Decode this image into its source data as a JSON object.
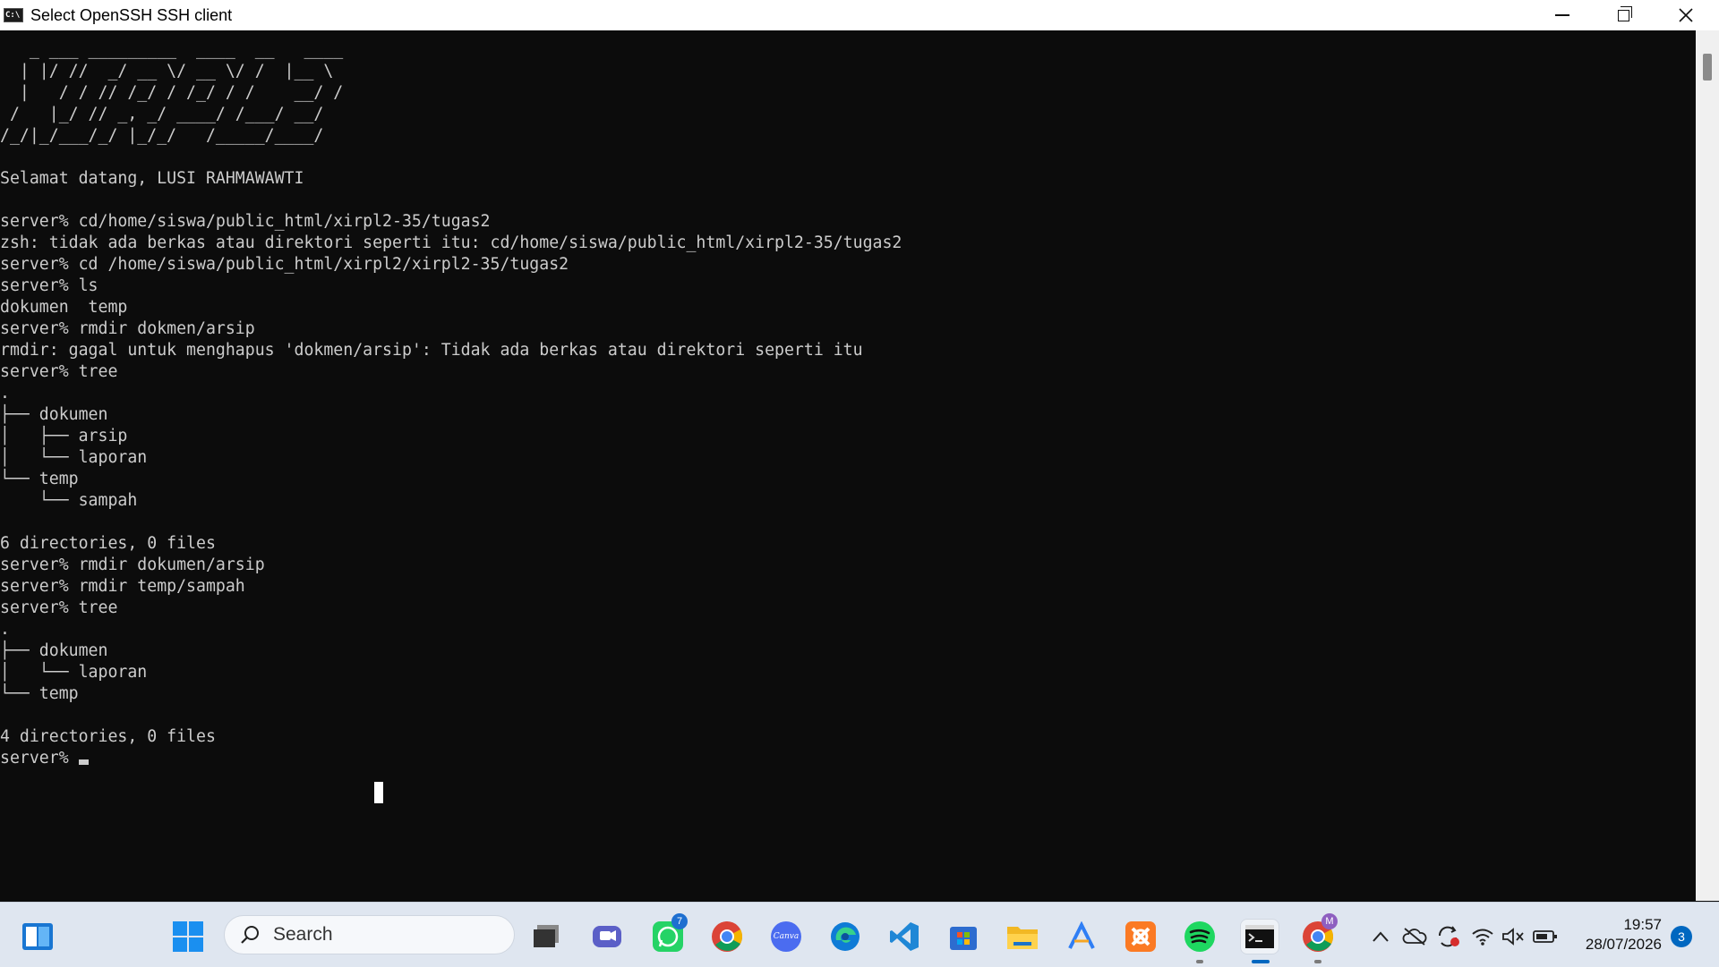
{
  "window": {
    "title": "Select OpenSSH SSH client"
  },
  "console": {
    "lines": [
      "   _ ___ _________  ____  __   ____",
      "  | |/ //  _/ __ \\/ __ \\/ /  |__ \\",
      "  |   / / // /_/ / /_/ / /    __/ /",
      " /   |_/ // _, _/ ____/ /___/ __/",
      "/_/|_/___/_/ |_/_/   /_____/____/",
      "",
      "Selamat datang, LUSI RAHMAWAWTI",
      "",
      "server% cd/home/siswa/public_html/xirpl2-35/tugas2",
      "zsh: tidak ada berkas atau direktori seperti itu: cd/home/siswa/public_html/xirpl2-35/tugas2",
      "server% cd /home/siswa/public_html/xirpl2/xirpl2-35/tugas2",
      "server% ls",
      "dokumen  temp",
      "server% rmdir dokmen/arsip",
      "rmdir: gagal untuk menghapus 'dokmen/arsip': Tidak ada berkas atau direktori seperti itu",
      "server% tree",
      ".",
      "├── dokumen",
      "│   ├── arsip",
      "│   └── laporan",
      "└── temp",
      "    └── sampah",
      "",
      "6 directories, 0 files",
      "server% rmdir dokumen/arsip",
      "server% rmdir temp/sampah",
      "server% tree",
      ".",
      "├── dokumen",
      "│   └── laporan",
      "└── temp",
      "",
      "4 directories, 0 files"
    ],
    "prompt": "server% "
  },
  "taskbar": {
    "search_label": "Search",
    "apps": [
      {
        "name": "task-view",
        "icon": "task-view-icon"
      },
      {
        "name": "teams",
        "icon": "teams-icon"
      },
      {
        "name": "whatsapp",
        "icon": "whatsapp-icon",
        "badge": "7"
      },
      {
        "name": "chrome",
        "icon": "chrome-icon"
      },
      {
        "name": "canva",
        "icon": "canva-icon",
        "label": "Canva"
      },
      {
        "name": "edge",
        "icon": "edge-icon"
      },
      {
        "name": "vscode",
        "icon": "vscode-icon"
      },
      {
        "name": "store",
        "icon": "store-icon"
      },
      {
        "name": "file-explorer",
        "icon": "folder-icon"
      },
      {
        "name": "arc",
        "icon": "arc-icon"
      },
      {
        "name": "xampp",
        "icon": "xampp-icon"
      },
      {
        "name": "spotify",
        "icon": "spotify-icon"
      },
      {
        "name": "terminal",
        "icon": "terminal-icon"
      },
      {
        "name": "chrome-profile",
        "icon": "chrome-icon",
        "badge": "M"
      }
    ],
    "clock": {
      "time": "19:57",
      "date": "28/07/2026"
    },
    "notifications": "3"
  },
  "colors": {
    "console_bg": "#0c0c0c",
    "console_fg": "#cccccc",
    "taskbar_bg": "#dfe6f0",
    "accent": "#0067c0"
  }
}
